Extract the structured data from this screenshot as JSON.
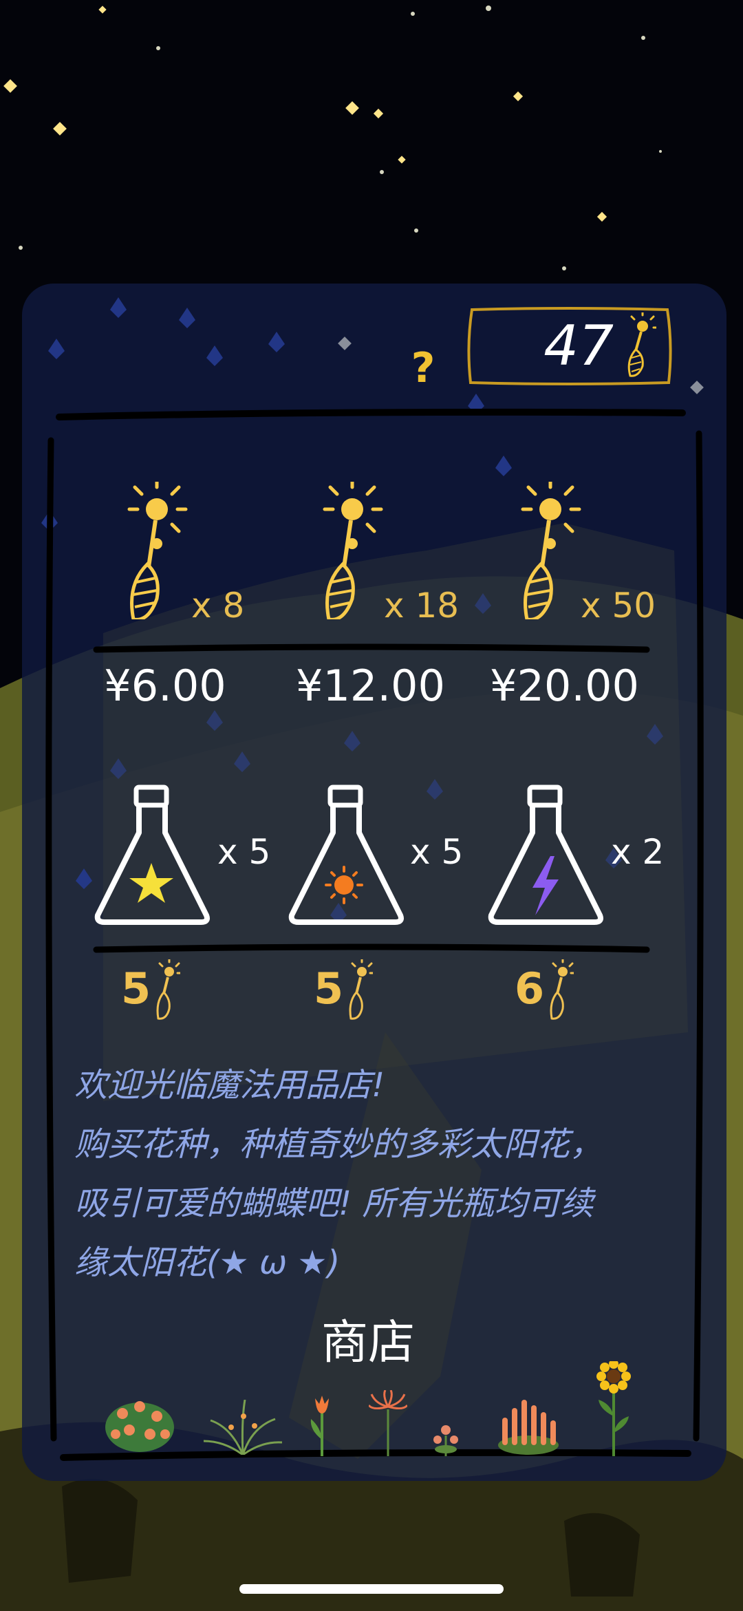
{
  "header": {
    "help_label": "?",
    "balance": "47"
  },
  "seed_offers": [
    {
      "quantity": "x 8",
      "price": "¥6.00"
    },
    {
      "quantity": "x 18",
      "price": "¥12.00"
    },
    {
      "quantity": "x 50",
      "price": "¥20.00"
    }
  ],
  "bottle_offers": [
    {
      "symbol": "star",
      "quantity": "x 5",
      "cost": "5"
    },
    {
      "symbol": "sun",
      "quantity": "x 5",
      "cost": "5"
    },
    {
      "symbol": "lightning",
      "quantity": "x 2",
      "cost": "6"
    }
  ],
  "welcome_lines": [
    "欢迎光临魔法用品店!",
    "购买花种，种植奇妙的多彩太阳花，",
    "吸引可爱的蝴蝶吧! 所有光瓶均可续",
    "缘太阳花(★ ω ★)"
  ],
  "shop_label": "商店",
  "colors": {
    "gold": "#f1c232",
    "panel": "#101a40",
    "text_blue": "#8fa6e6"
  },
  "icons": [
    "question-mark-icon",
    "seed-currency-icon",
    "flask-icon",
    "star-icon",
    "sun-icon",
    "lightning-icon",
    "flower-icon"
  ]
}
